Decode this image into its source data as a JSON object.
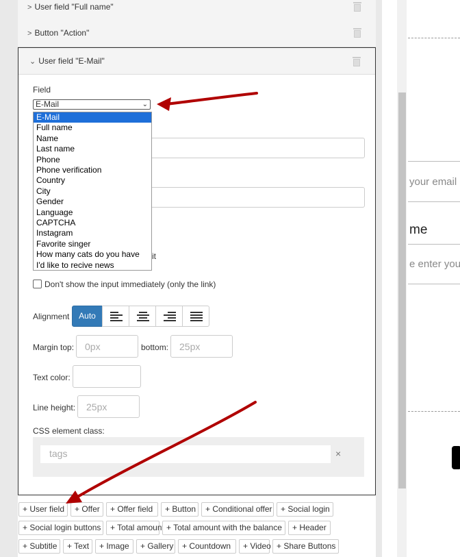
{
  "rows": [
    {
      "label": "User field \"Full name\""
    },
    {
      "label": "Button \"Action\""
    }
  ],
  "panel": {
    "title": "User field \"E-Mail\"",
    "field_label": "Field",
    "selected": "E-Mail",
    "options": [
      "E-Mail",
      "Full name",
      "Name",
      "Last name",
      "Phone",
      "Phone verification",
      "Country",
      "City",
      "Gender",
      "Language",
      "CAPTCHA",
      "Instagram",
      "Favorite singer",
      "How many cats do you have",
      "I'd like to recive news"
    ],
    "peek_text": "it",
    "checkbox_label": "Don't show the input immediately (only the link)",
    "alignment_label": "Alignment",
    "alignment_auto": "Auto",
    "margin_top_label": "Margin top:",
    "margin_top_placeholder": "0px",
    "bottom_label": "bottom:",
    "bottom_placeholder": "25px",
    "text_color_label": "Text color:",
    "line_height_label": "Line height:",
    "line_height_placeholder": "25px",
    "css_class_label": "CSS element class:",
    "tags_placeholder": "tags",
    "tags_clear": "×"
  },
  "toolbar": [
    [
      "+ User field",
      "+ Offer",
      "+ Offer field",
      "+ Button",
      "+ Conditional offer",
      "+ Social login"
    ],
    [
      "+ Social login buttons",
      "+ Total amount",
      "+ Total amount with the balance",
      "+ Header"
    ],
    [
      "+ Subtitle",
      "+ Text",
      "+ Image",
      "+ Gallery",
      "+ Countdown",
      "+ Video",
      "+ Share Buttons"
    ]
  ],
  "preview": {
    "email_placeholder": "your email",
    "name_heading": "me",
    "enter_text": "e enter you"
  },
  "colors": {
    "accent": "#337ab7",
    "arrow": "#b00000",
    "selected_option": "#1e6fd9"
  }
}
